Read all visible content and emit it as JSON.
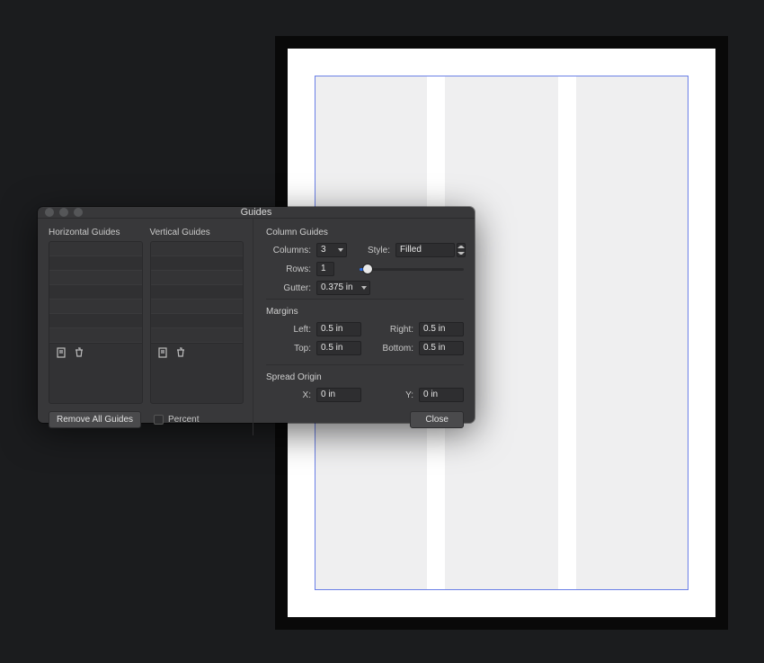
{
  "dialog": {
    "title": "Guides",
    "left": {
      "horizontal_label": "Horizontal Guides",
      "vertical_label": "Vertical Guides",
      "remove_all": "Remove All Guides",
      "percent_label": "Percent"
    },
    "column_guides": {
      "section": "Column Guides",
      "columns_label": "Columns:",
      "columns_value": "3",
      "style_label": "Style:",
      "style_value": "Filled",
      "rows_label": "Rows:",
      "rows_value": "1",
      "gutter_label": "Gutter:",
      "gutter_value": "0.375 in"
    },
    "margins": {
      "section": "Margins",
      "left_label": "Left:",
      "left_value": "0.5 in",
      "right_label": "Right:",
      "right_value": "0.5 in",
      "top_label": "Top:",
      "top_value": "0.5 in",
      "bottom_label": "Bottom:",
      "bottom_value": "0.5 in"
    },
    "spread": {
      "section": "Spread Origin",
      "x_label": "X:",
      "x_value": "0 in",
      "y_label": "Y:",
      "y_value": "0 in"
    },
    "close": "Close"
  }
}
